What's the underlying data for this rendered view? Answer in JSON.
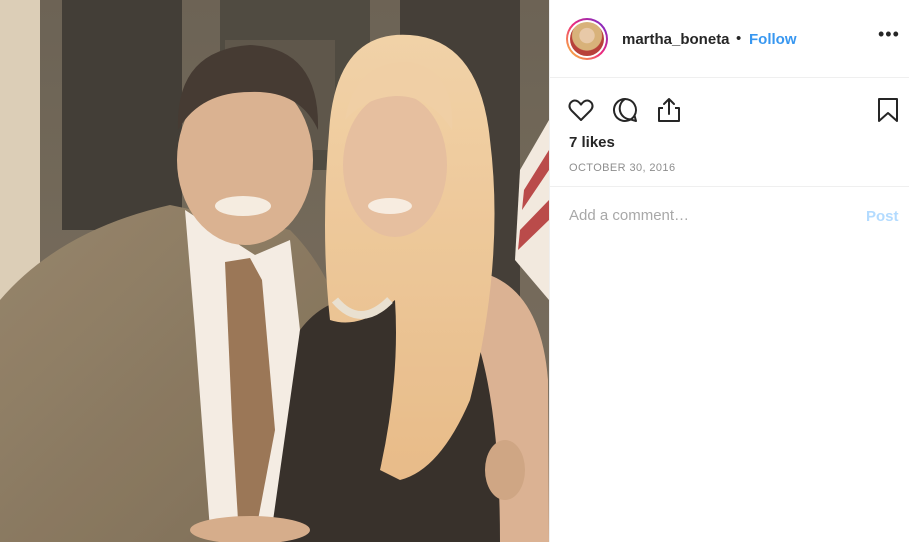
{
  "post": {
    "username": "martha_boneta",
    "separator": "•",
    "follow_label": "Follow",
    "more_label": "•••",
    "likes_text": "7 likes",
    "date_text": "OCTOBER 30, 2016"
  },
  "comment": {
    "placeholder": "Add a comment…",
    "post_label": "Post"
  },
  "icons": {
    "like": "heart-icon",
    "comment": "comment-bubble-icon",
    "share": "share-icon",
    "save": "bookmark-icon"
  },
  "colors": {
    "accent": "#3897f0",
    "post_disabled": "#b3dbff",
    "text": "#262626",
    "muted": "#8e8e8e"
  }
}
